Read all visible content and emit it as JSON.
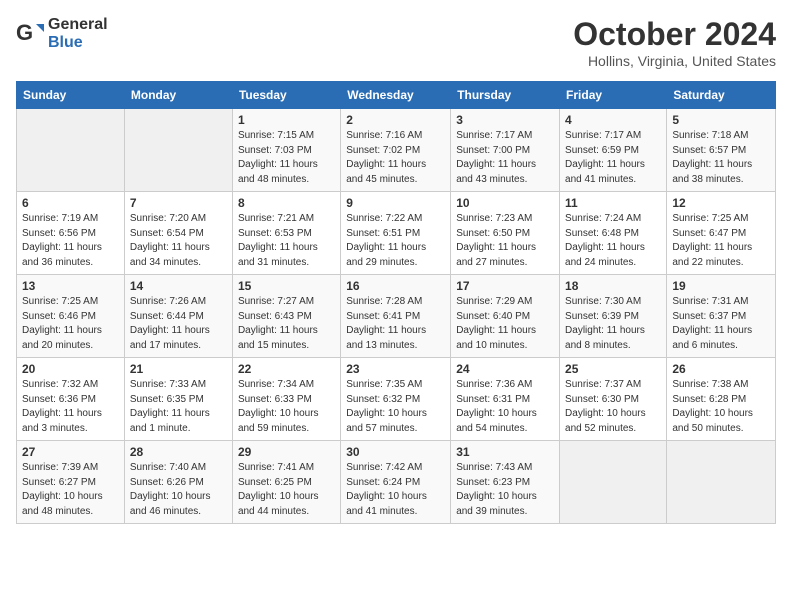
{
  "header": {
    "logo_general": "General",
    "logo_blue": "Blue",
    "title": "October 2024",
    "subtitle": "Hollins, Virginia, United States"
  },
  "weekdays": [
    "Sunday",
    "Monday",
    "Tuesday",
    "Wednesday",
    "Thursday",
    "Friday",
    "Saturday"
  ],
  "weeks": [
    [
      {
        "day": "",
        "info": ""
      },
      {
        "day": "",
        "info": ""
      },
      {
        "day": "1",
        "info": "Sunrise: 7:15 AM\nSunset: 7:03 PM\nDaylight: 11 hours and 48 minutes."
      },
      {
        "day": "2",
        "info": "Sunrise: 7:16 AM\nSunset: 7:02 PM\nDaylight: 11 hours and 45 minutes."
      },
      {
        "day": "3",
        "info": "Sunrise: 7:17 AM\nSunset: 7:00 PM\nDaylight: 11 hours and 43 minutes."
      },
      {
        "day": "4",
        "info": "Sunrise: 7:17 AM\nSunset: 6:59 PM\nDaylight: 11 hours and 41 minutes."
      },
      {
        "day": "5",
        "info": "Sunrise: 7:18 AM\nSunset: 6:57 PM\nDaylight: 11 hours and 38 minutes."
      }
    ],
    [
      {
        "day": "6",
        "info": "Sunrise: 7:19 AM\nSunset: 6:56 PM\nDaylight: 11 hours and 36 minutes."
      },
      {
        "day": "7",
        "info": "Sunrise: 7:20 AM\nSunset: 6:54 PM\nDaylight: 11 hours and 34 minutes."
      },
      {
        "day": "8",
        "info": "Sunrise: 7:21 AM\nSunset: 6:53 PM\nDaylight: 11 hours and 31 minutes."
      },
      {
        "day": "9",
        "info": "Sunrise: 7:22 AM\nSunset: 6:51 PM\nDaylight: 11 hours and 29 minutes."
      },
      {
        "day": "10",
        "info": "Sunrise: 7:23 AM\nSunset: 6:50 PM\nDaylight: 11 hours and 27 minutes."
      },
      {
        "day": "11",
        "info": "Sunrise: 7:24 AM\nSunset: 6:48 PM\nDaylight: 11 hours and 24 minutes."
      },
      {
        "day": "12",
        "info": "Sunrise: 7:25 AM\nSunset: 6:47 PM\nDaylight: 11 hours and 22 minutes."
      }
    ],
    [
      {
        "day": "13",
        "info": "Sunrise: 7:25 AM\nSunset: 6:46 PM\nDaylight: 11 hours and 20 minutes."
      },
      {
        "day": "14",
        "info": "Sunrise: 7:26 AM\nSunset: 6:44 PM\nDaylight: 11 hours and 17 minutes."
      },
      {
        "day": "15",
        "info": "Sunrise: 7:27 AM\nSunset: 6:43 PM\nDaylight: 11 hours and 15 minutes."
      },
      {
        "day": "16",
        "info": "Sunrise: 7:28 AM\nSunset: 6:41 PM\nDaylight: 11 hours and 13 minutes."
      },
      {
        "day": "17",
        "info": "Sunrise: 7:29 AM\nSunset: 6:40 PM\nDaylight: 11 hours and 10 minutes."
      },
      {
        "day": "18",
        "info": "Sunrise: 7:30 AM\nSunset: 6:39 PM\nDaylight: 11 hours and 8 minutes."
      },
      {
        "day": "19",
        "info": "Sunrise: 7:31 AM\nSunset: 6:37 PM\nDaylight: 11 hours and 6 minutes."
      }
    ],
    [
      {
        "day": "20",
        "info": "Sunrise: 7:32 AM\nSunset: 6:36 PM\nDaylight: 11 hours and 3 minutes."
      },
      {
        "day": "21",
        "info": "Sunrise: 7:33 AM\nSunset: 6:35 PM\nDaylight: 11 hours and 1 minute."
      },
      {
        "day": "22",
        "info": "Sunrise: 7:34 AM\nSunset: 6:33 PM\nDaylight: 10 hours and 59 minutes."
      },
      {
        "day": "23",
        "info": "Sunrise: 7:35 AM\nSunset: 6:32 PM\nDaylight: 10 hours and 57 minutes."
      },
      {
        "day": "24",
        "info": "Sunrise: 7:36 AM\nSunset: 6:31 PM\nDaylight: 10 hours and 54 minutes."
      },
      {
        "day": "25",
        "info": "Sunrise: 7:37 AM\nSunset: 6:30 PM\nDaylight: 10 hours and 52 minutes."
      },
      {
        "day": "26",
        "info": "Sunrise: 7:38 AM\nSunset: 6:28 PM\nDaylight: 10 hours and 50 minutes."
      }
    ],
    [
      {
        "day": "27",
        "info": "Sunrise: 7:39 AM\nSunset: 6:27 PM\nDaylight: 10 hours and 48 minutes."
      },
      {
        "day": "28",
        "info": "Sunrise: 7:40 AM\nSunset: 6:26 PM\nDaylight: 10 hours and 46 minutes."
      },
      {
        "day": "29",
        "info": "Sunrise: 7:41 AM\nSunset: 6:25 PM\nDaylight: 10 hours and 44 minutes."
      },
      {
        "day": "30",
        "info": "Sunrise: 7:42 AM\nSunset: 6:24 PM\nDaylight: 10 hours and 41 minutes."
      },
      {
        "day": "31",
        "info": "Sunrise: 7:43 AM\nSunset: 6:23 PM\nDaylight: 10 hours and 39 minutes."
      },
      {
        "day": "",
        "info": ""
      },
      {
        "day": "",
        "info": ""
      }
    ]
  ]
}
